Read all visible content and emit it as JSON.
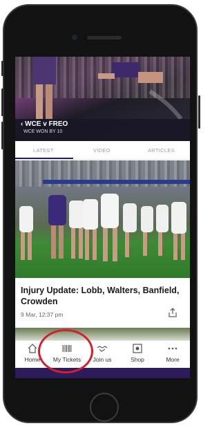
{
  "hero": {
    "title": "WCE v FREO",
    "subtitle": "WCE WON BY 10"
  },
  "tabs": [
    {
      "label": "LATEST",
      "active": true
    },
    {
      "label": "VIDEO",
      "active": false
    },
    {
      "label": "ARTICLES",
      "active": false
    }
  ],
  "article": {
    "headline": "Injury Update: Lobb, Walters, Banfield, Crowden",
    "meta": "9 Mar, 12:37 pm"
  },
  "nav": [
    {
      "label": "Home",
      "icon": "home-icon"
    },
    {
      "label": "My Tickets",
      "icon": "barcode-icon"
    },
    {
      "label": "Join us",
      "icon": "handshake-icon"
    },
    {
      "label": "Shop",
      "icon": "shop-icon"
    },
    {
      "label": "More",
      "icon": "more-icon"
    }
  ],
  "colors": {
    "brand": "#2d1b5a",
    "annotation": "#d2202e",
    "tab_active": "#2a1a5e"
  }
}
